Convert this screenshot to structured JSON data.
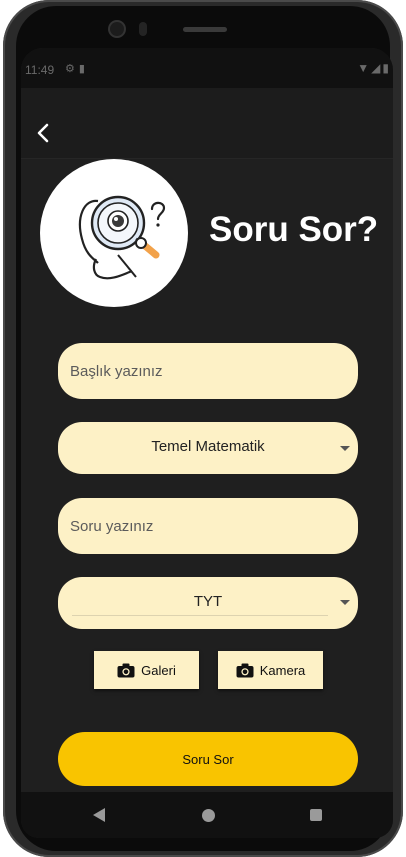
{
  "status_bar": {
    "time": "11:49",
    "left_icons": [
      "settings-icon",
      "sd-card-icon"
    ],
    "right_icons": [
      "wifi-icon",
      "signal-icon",
      "battery-icon"
    ]
  },
  "header": {
    "back_icon": "arrow-back-icon",
    "title": "Soru Sor?",
    "illustration": "magnifier-question-illustration"
  },
  "form": {
    "title_placeholder": "Başlık yazınız",
    "subject_selected": "Temel Matematik",
    "question_placeholder": "Soru yazınız",
    "exam_selected": "TYT"
  },
  "buttons": {
    "gallery_label": "Galeri",
    "camera_label": "Kamera",
    "submit_label": "Soru Sor"
  },
  "colors": {
    "background": "#1f1f1f",
    "field": "#fdf1c6",
    "accent": "#f9c400",
    "title_text": "#ffffff"
  },
  "nav_bar": [
    "back-triangle-icon",
    "home-circle-icon",
    "recents-square-icon"
  ]
}
